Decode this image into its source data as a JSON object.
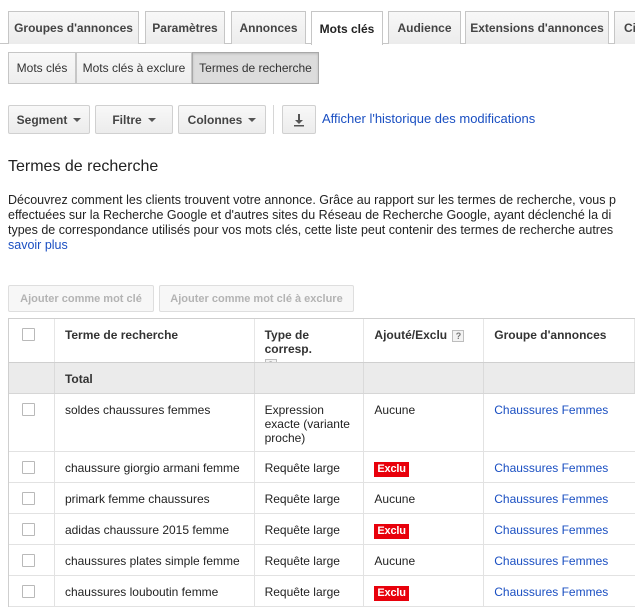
{
  "top_tabs": [
    {
      "label": "Groupes d'annonces"
    },
    {
      "label": "Paramètres"
    },
    {
      "label": "Annonces"
    },
    {
      "label": "Mots clés"
    },
    {
      "label": "Audience"
    },
    {
      "label": "Extensions d'annonces"
    },
    {
      "label": "Ci"
    }
  ],
  "sub_tabs": [
    {
      "label": "Mots clés"
    },
    {
      "label": "Mots clés à exclure"
    },
    {
      "label": "Termes de recherche"
    }
  ],
  "toolbar": {
    "segment_label": "Segment",
    "filter_label": "Filtre",
    "columns_label": "Colonnes",
    "history_link": "Afficher l'historique des modifications"
  },
  "page_title": "Termes de recherche",
  "description": {
    "line1": "Découvrez comment les clients trouvent votre annonce. Grâce au rapport sur les termes de recherche, vous p",
    "line2": "effectuées sur la Recherche Google et d'autres sites du Réseau de Recherche Google, ayant déclenché la di",
    "line3": "types de correspondance utilisés pour vos mots clés, cette liste peut contenir des termes de recherche autres",
    "learn_more": "savoir plus"
  },
  "actions": {
    "add_keyword": "Ajouter comme mot clé",
    "add_negative": "Ajouter comme mot clé à exclure"
  },
  "table": {
    "headers": {
      "term": "Terme de recherche",
      "match_type": "Type de corresp.",
      "added": "Ajouté/Exclu",
      "ad_group": "Groupe d'annonces",
      "help": "?"
    },
    "total_label": "Total",
    "rows": [
      {
        "term": "soldes chaussures femmes",
        "match_type": "Expression exacte (variante proche)",
        "added": "Aucune",
        "ad_group": "Chaussures Femmes"
      },
      {
        "term": "chaussure giorgio armani femme",
        "match_type": "Requête large",
        "added": "Exclu",
        "ad_group": "Chaussures Femmes"
      },
      {
        "term": "primark femme chaussures",
        "match_type": "Requête large",
        "added": "Aucune",
        "ad_group": "Chaussures Femmes"
      },
      {
        "term": "adidas chaussure 2015 femme",
        "match_type": "Requête large",
        "added": "Exclu",
        "ad_group": "Chaussures Femmes"
      },
      {
        "term": "chaussures plates simple femme",
        "match_type": "Requête large",
        "added": "Aucune",
        "ad_group": "Chaussures Femmes"
      },
      {
        "term": "chaussures louboutin femme",
        "match_type": "Requête large",
        "added": "Exclu",
        "ad_group": "Chaussures Femmes"
      }
    ]
  },
  "colors": {
    "link": "#1a4fc2",
    "excluded_badge": "#e8000b",
    "total_row_bg": "#ebebeb"
  }
}
